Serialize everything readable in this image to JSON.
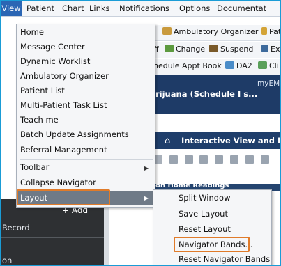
{
  "menubar": {
    "items": [
      "View",
      "Patient",
      "Chart",
      "Links",
      "Notifications",
      "Options",
      "Documentat"
    ]
  },
  "toolbar": {
    "row1": [
      "Ambulatory Organizer",
      "Pat"
    ],
    "row2": [
      "ff",
      "Change",
      "Suspend",
      "Ex"
    ],
    "row3": [
      "hedule Appt Book",
      "DA2",
      "Cli"
    ]
  },
  "patient_banner": {
    "org": "myEMH",
    "name": "rijuana (Schedule I s..."
  },
  "iview_title": "Interactive View and I&",
  "section_label": "on Home Readings",
  "left_panel": {
    "add_label": "Add",
    "record_label": "Record",
    "bottom_label": "on"
  },
  "view_menu": {
    "items": [
      "Home",
      "Message Center",
      "Dynamic Worklist",
      "Ambulatory Organizer",
      "Patient List",
      "Multi-Patient Task List",
      "Teach me",
      "Batch Update Assignments",
      "Referral Management",
      "Toolbar",
      "Collapse Navigator",
      "Layout"
    ]
  },
  "layout_submenu": {
    "items": [
      "Split Window",
      "Save Layout",
      "Reset Layout",
      "Navigator Bands...",
      "Reset Navigator Bands"
    ]
  },
  "colors": {
    "accent_outline": "#e07b2a",
    "menubar_selected": "#2b66b4",
    "banner_navy": "#1e3b67"
  }
}
